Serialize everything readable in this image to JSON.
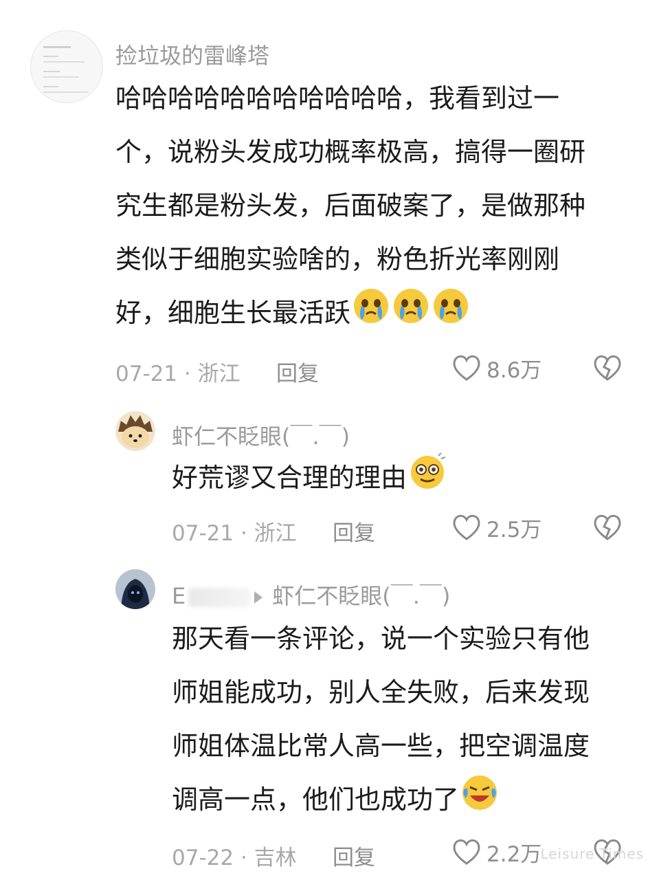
{
  "comments": [
    {
      "username": "捡垃圾的雷峰塔",
      "text_lines": [
        "哈哈哈哈哈哈哈哈哈哈哈，我看到过一",
        "个，说粉头发成功概率极高，搞得一圈研",
        "究生都是粉头发，后面破案了，是做那种",
        "类似于细胞实验啥的，粉色折光率刚刚",
        "好，细胞生长最活跃"
      ],
      "date": "07-21",
      "location": "浙江",
      "reply_label": "回复",
      "likes": "8.6万",
      "trailing_emoji": "crying-emoji ×3"
    },
    {
      "username": "虾仁不眨眼(￣.￣)",
      "text_lines": [
        "好荒谬又合理的理由"
      ],
      "date": "07-21",
      "location": "浙江",
      "reply_label": "回复",
      "likes": "2.5万",
      "trailing_emoji": "dizzy-eyes-emoji"
    },
    {
      "username": "E",
      "reply_to": "虾仁不眨眼(￣.￣)",
      "text_lines": [
        "那天看一条评论，说一个实验只有他",
        "师姐能成功，别人全失败，后来发现",
        "师姐体温比常人高一些，把空调温度",
        "调高一点，他们也成功了"
      ],
      "date": "07-22",
      "location": "吉林",
      "reply_label": "回复",
      "likes": "2.2万",
      "trailing_emoji": "laughing-crying-emoji"
    }
  ],
  "separator": " · ",
  "watermark": "Leisure Times",
  "colors": {
    "meta_gray": "#a8a8a8",
    "text": "#1b1b1b",
    "emoji_yellow": "#f7c93c",
    "tear_blue": "#4aa3e8"
  }
}
